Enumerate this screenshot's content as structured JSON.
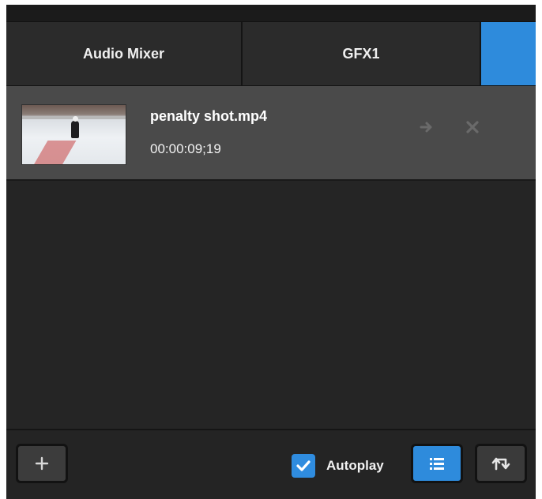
{
  "tabs": [
    {
      "label": "Audio Mixer"
    },
    {
      "label": "GFX1"
    },
    {
      "label": ""
    }
  ],
  "media_list": {
    "items": [
      {
        "title": "penalty shot.mp4",
        "duration": "00:00:09;19",
        "thumbnail_icon": "hockey-video-thumbnail"
      }
    ]
  },
  "item_actions": {
    "send_icon": "arrow-right-icon",
    "remove_icon": "close-icon"
  },
  "toolbar": {
    "add_icon": "plus-icon",
    "autoplay_label": "Autoplay",
    "autoplay_checked": true,
    "playlist_icon": "playlist-icon",
    "loop_icon": "loop-icon"
  },
  "colors": {
    "accent": "#2e8bdc",
    "panel_bg": "#232323",
    "selected_item_bg": "#4a4a4a"
  }
}
